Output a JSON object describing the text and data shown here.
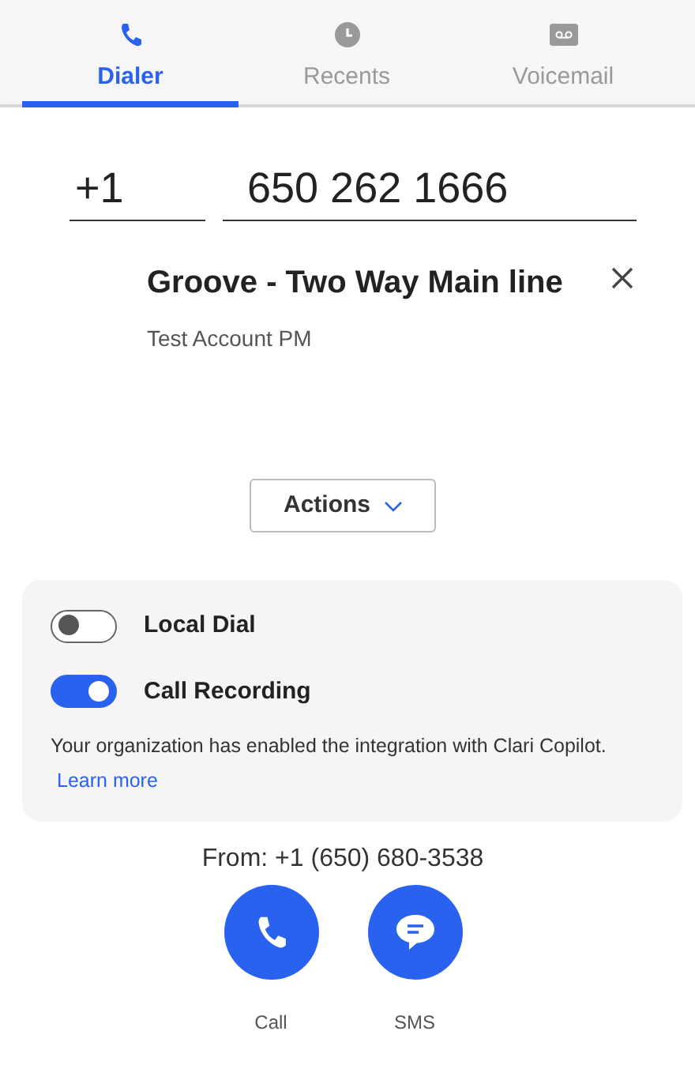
{
  "tabs": [
    {
      "label": "Dialer",
      "kind": "phone",
      "selected": true
    },
    {
      "label": "Recents",
      "kind": "clock",
      "selected": false
    },
    {
      "label": "Voicemail",
      "kind": "voicemail",
      "selected": false
    }
  ],
  "dial": {
    "country_code": "+1",
    "number": "650 262 1666"
  },
  "contact": {
    "name": "Groove - Two Way Main line",
    "account": "Test Account PM"
  },
  "actions_button": "Actions",
  "settings": {
    "toggles": [
      {
        "label": "Local Dial",
        "on": false
      },
      {
        "label": "Call Recording",
        "on": true
      }
    ],
    "note": "Your organization has enabled the integration with Clari Copilot.",
    "link": "Learn more"
  },
  "from": "From: +1 (650) 680-3538",
  "buttons": [
    {
      "label": "Call",
      "kind": "call"
    },
    {
      "label": "SMS",
      "kind": "sms"
    }
  ]
}
